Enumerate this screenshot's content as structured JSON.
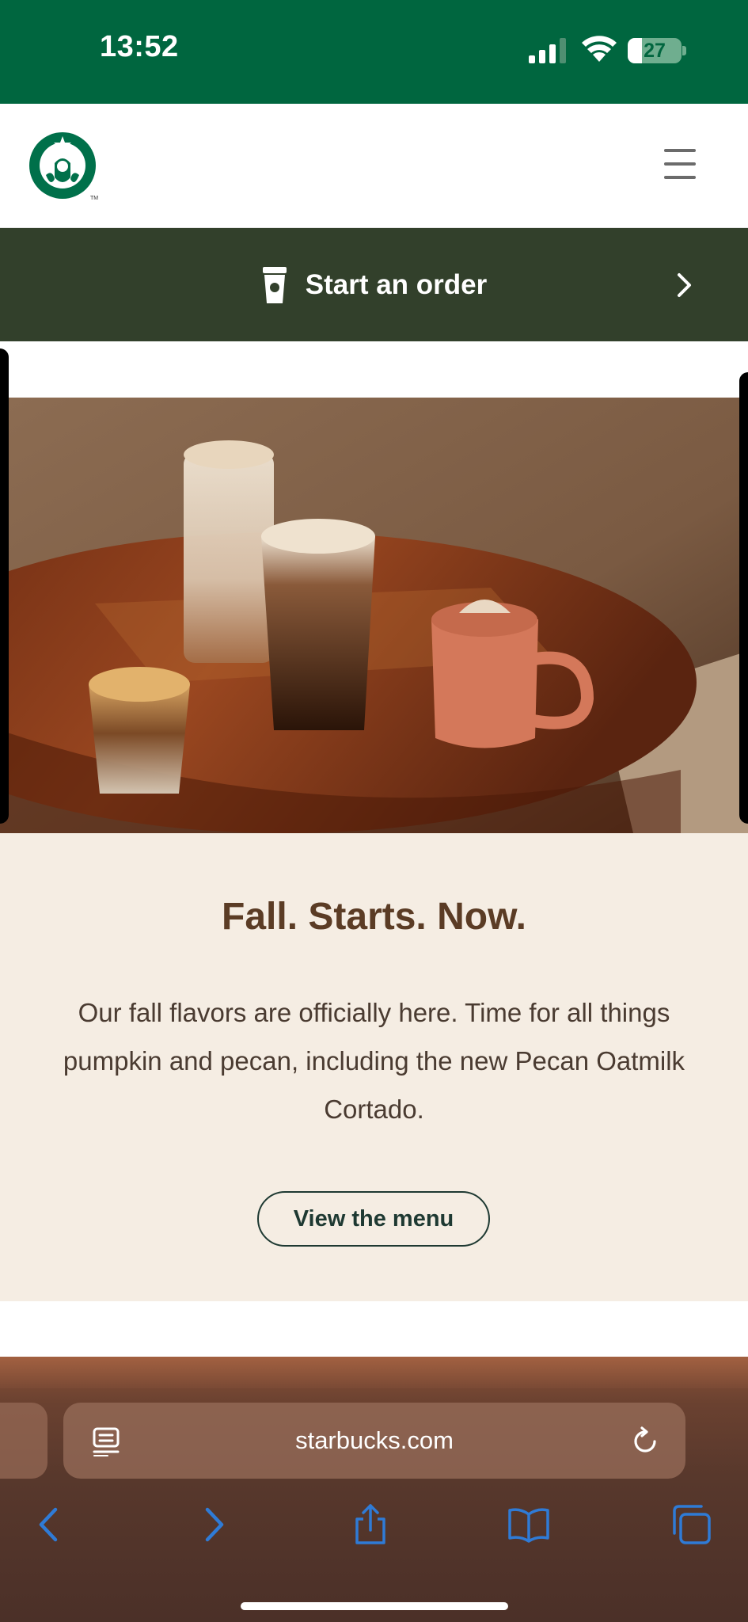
{
  "status_bar": {
    "time": "13:52",
    "battery_level": "27",
    "battery_fraction": 0.27,
    "background_color": "#00663f"
  },
  "header": {
    "logo_icon": "starbucks-siren-logo",
    "menu_icon": "hamburger-menu-icon"
  },
  "order_bar": {
    "label": "Start an order",
    "cup_icon": "cup-icon",
    "chevron_icon": "chevron-right-icon",
    "background_color": "#32402b"
  },
  "promo": {
    "title": "Fall. Starts. Now.",
    "body": "Our fall flavors are officially here. Time for all things pumpkin and pecan, including the new Pecan Oatmilk Cortado.",
    "button_label": "View the menu",
    "background_color": "#f5ede3"
  },
  "browser": {
    "url": "starbucks.com",
    "reader_icon": "reader-mode-icon",
    "reload_icon": "reload-icon",
    "toolbar": [
      "back-icon",
      "forward-icon",
      "share-icon",
      "bookmarks-icon",
      "tabs-icon"
    ],
    "accent_color": "#2f7bd6"
  }
}
